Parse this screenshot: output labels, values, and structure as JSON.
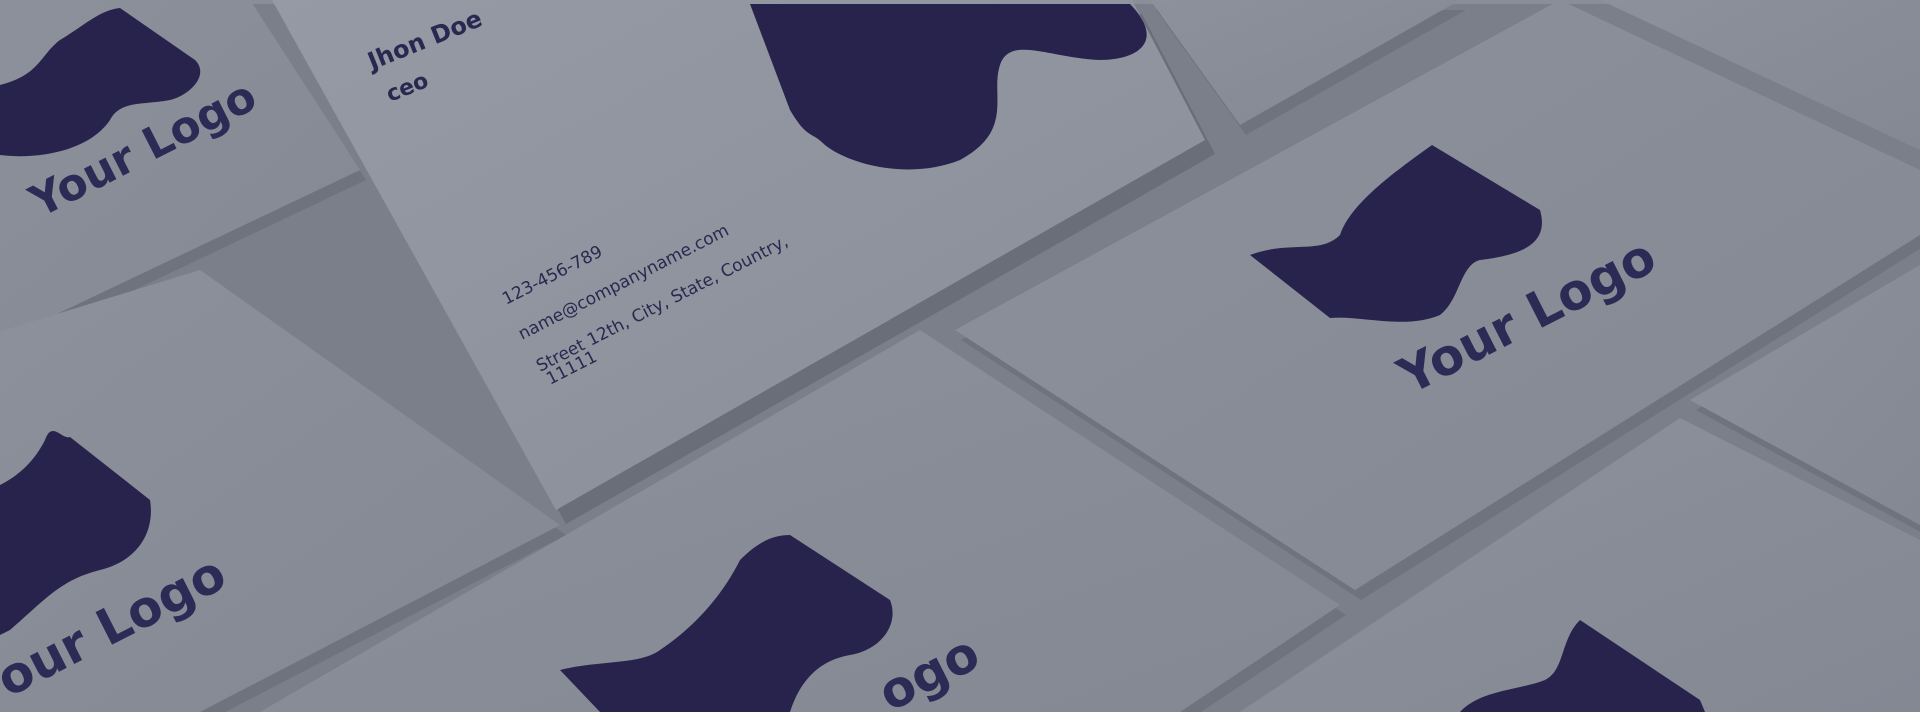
{
  "colors": {
    "background": "#7b7f8a",
    "card": "#898d97",
    "card_front": "#8e929c",
    "ink": "#2d2a55",
    "shadow": "#6d717b"
  },
  "business_card": {
    "name": "Jhon Doe",
    "title": "ceo",
    "phone": "123-456-789",
    "email": "name@companyname.com",
    "address_line1": "Street 12th, City, State, Country,",
    "address_line2": "11111"
  },
  "logo_cards": [
    {
      "logo_label": "Your Logo",
      "icon": "wave-logo-icon"
    },
    {
      "logo_label": "Your Logo",
      "icon": "wave-logo-icon"
    },
    {
      "logo_label": "Your Logo",
      "icon": "wave-logo-icon"
    },
    {
      "logo_label": "ogo",
      "icon": "wave-logo-icon"
    },
    {
      "logo_label": "",
      "icon": "wave-logo-icon"
    }
  ]
}
